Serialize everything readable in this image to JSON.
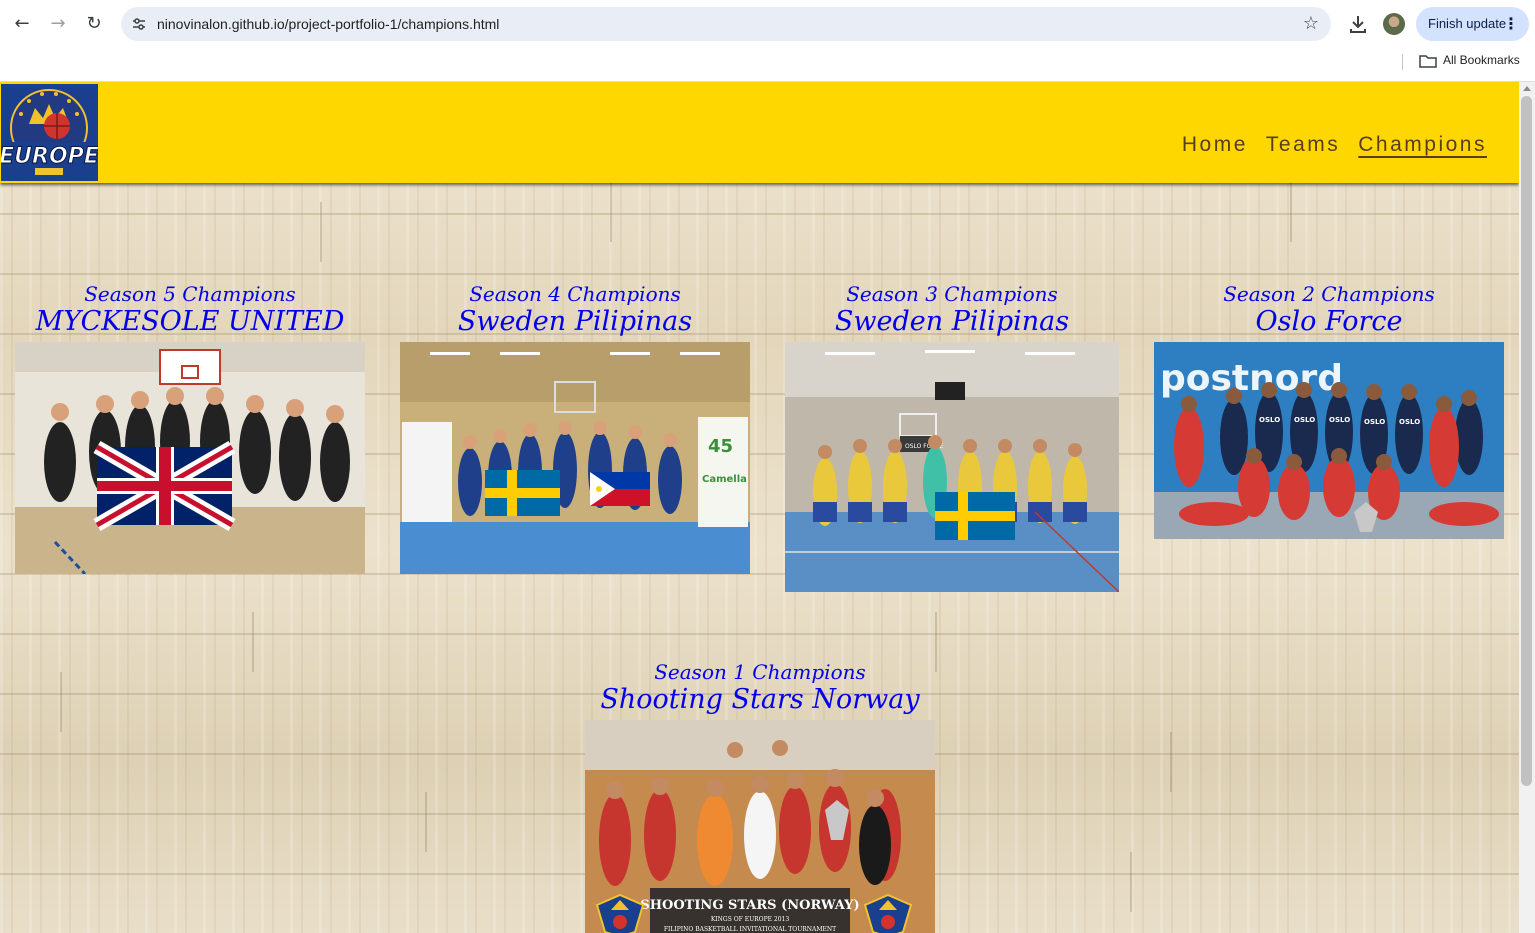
{
  "browser": {
    "url": "ninovinalon.github.io/project-portfolio-1/champions.html",
    "finish_update_label": "Finish update",
    "all_bookmarks_label": "All Bookmarks"
  },
  "site": {
    "logo_alt": "Kings of Europe",
    "nav": [
      {
        "label": "Home"
      },
      {
        "label": "Teams"
      },
      {
        "label": "Champions"
      }
    ]
  },
  "champions": [
    {
      "season": "Season 5 Champions",
      "team": "MYCKESOLE UNITED",
      "flag": "uk"
    },
    {
      "season": "Season 4 Champions",
      "team": "Sweden Pilipinas",
      "flag": "sweden-philippines"
    },
    {
      "season": "Season 3 Champions",
      "team": "Sweden Pilipinas",
      "flag": "sweden"
    },
    {
      "season": "Season 2 Champions",
      "team": "Oslo Force",
      "banner": "postnord"
    },
    {
      "season": "Season 1 Champions",
      "team": "Shooting Stars Norway",
      "caption": "SHOOTING STARS (NORWAY)",
      "caption_sub1": "KINGS OF EUROPE 2013",
      "caption_sub2": "FILIPINO BASKETBALL INVITATIONAL TOURNAMENT"
    }
  ],
  "photo_text": {
    "s4_sponsor": "Camella",
    "s4_year": "45",
    "s3_banner": "OSLO FORCE",
    "s2_brand": "postnord",
    "s2_jersey": "OSLO"
  }
}
